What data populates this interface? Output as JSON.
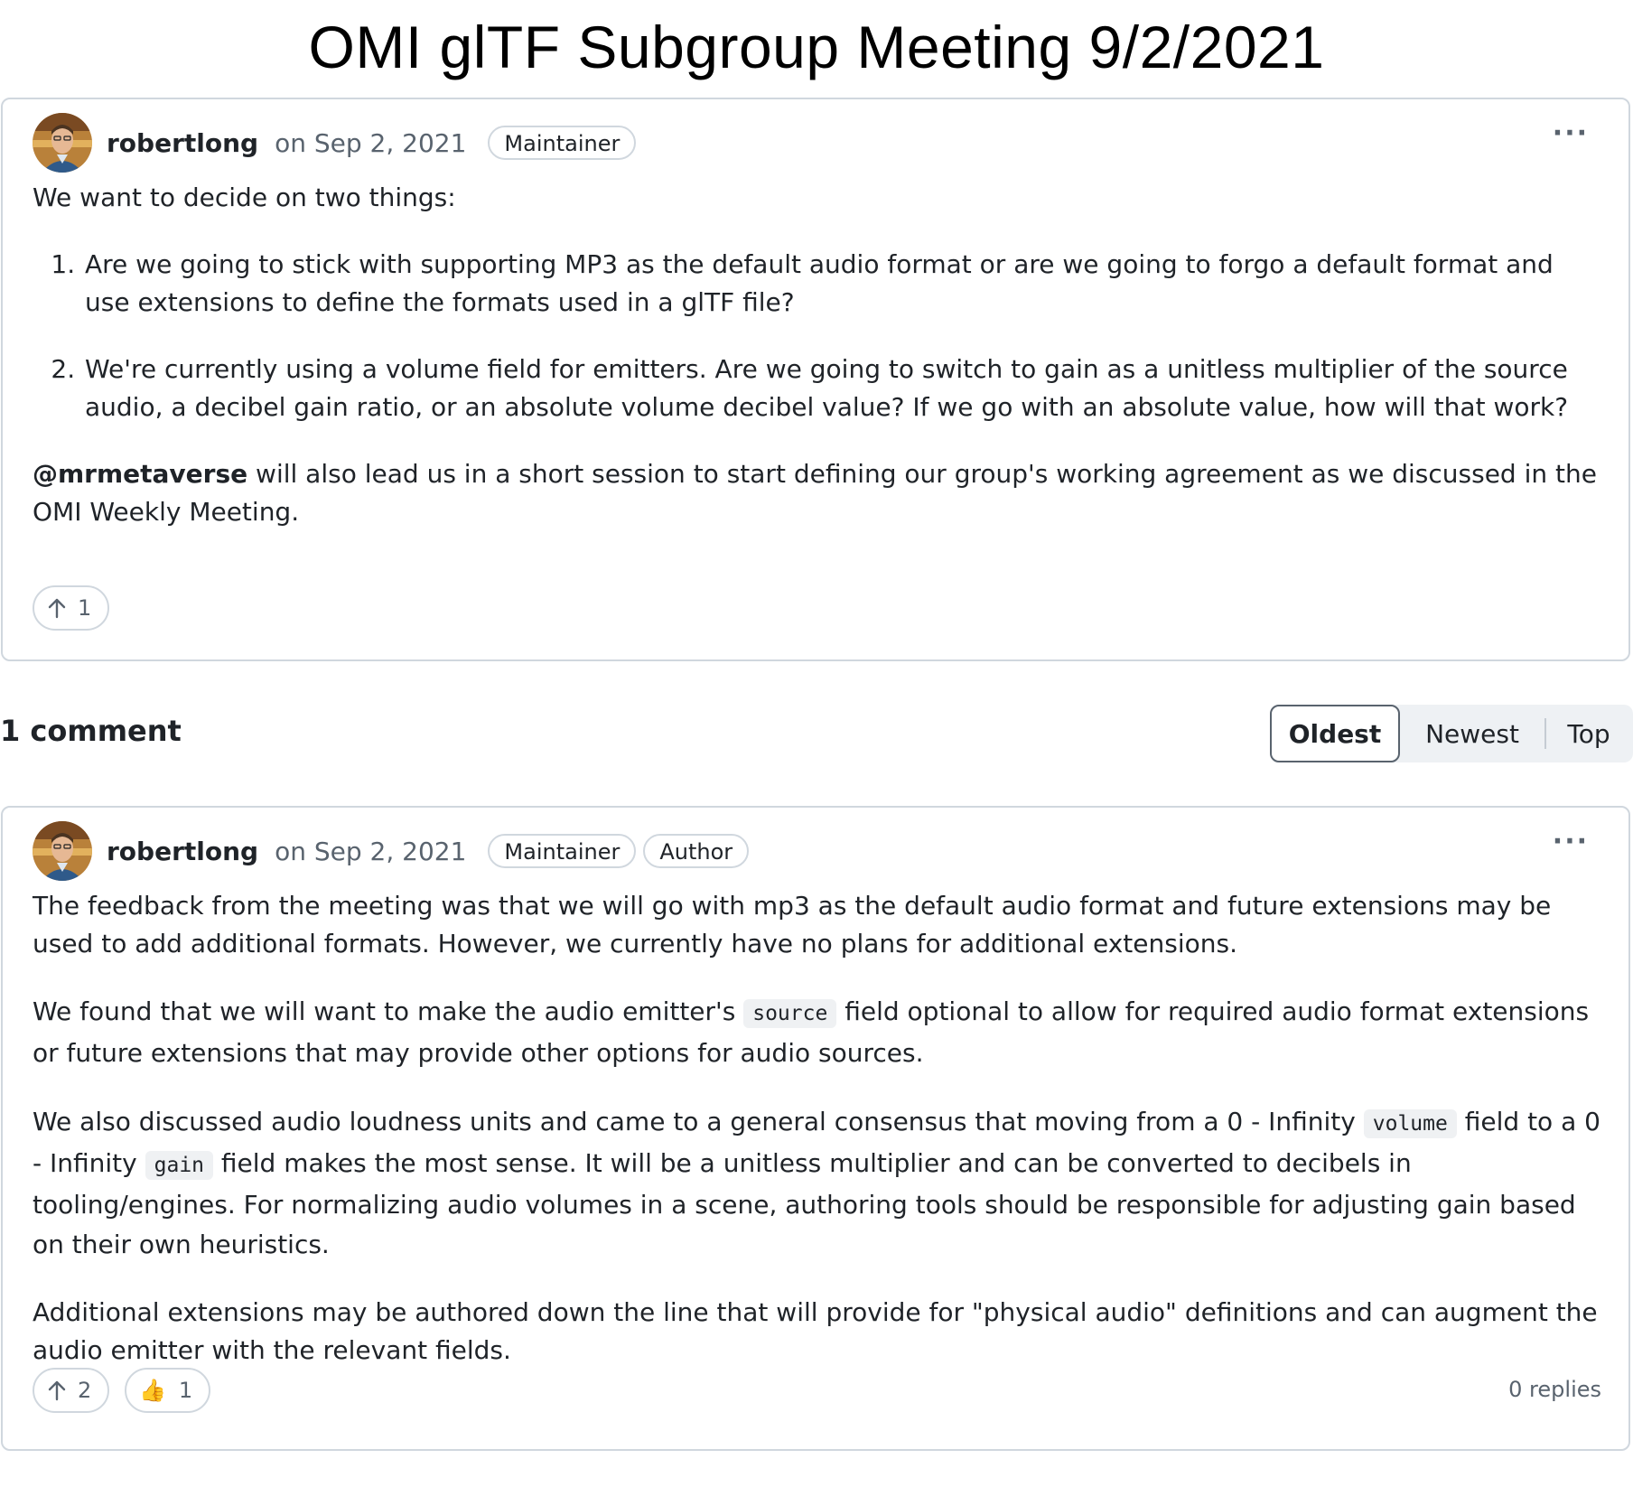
{
  "page": {
    "title": "OMI glTF Subgroup Meeting 9/2/2021"
  },
  "post": {
    "author": "robertlong",
    "date": "on Sep 2, 2021",
    "badges": [
      "Maintainer"
    ],
    "intro": "We want to decide on two things:",
    "items": [
      "Are we going to stick with supporting MP3 as the default audio format or are we going to forgo a default format and use extensions to define the formats used in a glTF file?",
      "We're currently using a volume field for emitters. Are we going to switch to gain as a unitless multiplier of the source audio, a decibel gain ratio, or an absolute volume decibel value? If we go with an absolute value, how will that work?"
    ],
    "mention": "@mrmetaverse",
    "closing": " will also lead us in a short session to start defining our group's working agreement as we discussed in the OMI Weekly Meeting.",
    "upvotes": "1"
  },
  "comments_header": {
    "count_label": "1 comment",
    "sort_options": [
      "Oldest",
      "Newest",
      "Top"
    ],
    "selected_sort": "Oldest"
  },
  "comment": {
    "author": "robertlong",
    "date": "on Sep 2, 2021",
    "badges": [
      "Maintainer",
      "Author"
    ],
    "p1": "The feedback from the meeting was that we will go with mp3 as the default audio format and future extensions may be used to add additional formats. However, we currently have no plans for additional extensions.",
    "p2_a": "We found that we will want to make the audio emitter's ",
    "p2_code": "source",
    "p2_b": " field optional to allow for required audio format extensions or future extensions that may provide other options for audio sources.",
    "p3_a": "We also discussed audio loudness units and came to a general consensus that moving from a 0 - Infinity ",
    "p3_code1": "volume",
    "p3_b": " field to a 0 - Infinity ",
    "p3_code2": "gain",
    "p3_c": " field makes the most sense. It will be a unitless multiplier and can be converted to decibels in tooling/engines. For normalizing audio volumes in a scene, authoring tools should be responsible for adjusting gain based on their own heuristics.",
    "p4": "Additional extensions may be authored down the line that will provide for \"physical audio\" definitions and can augment the audio emitter with the relevant fields.",
    "upvotes": "2",
    "thumbs_up": "1",
    "replies": "0 replies"
  },
  "icons": {
    "upvote": "arrow-up-icon",
    "thumbs": "thumbs-up-icon",
    "more": "kebab-horizontal-icon",
    "avatar": "user-avatar"
  }
}
